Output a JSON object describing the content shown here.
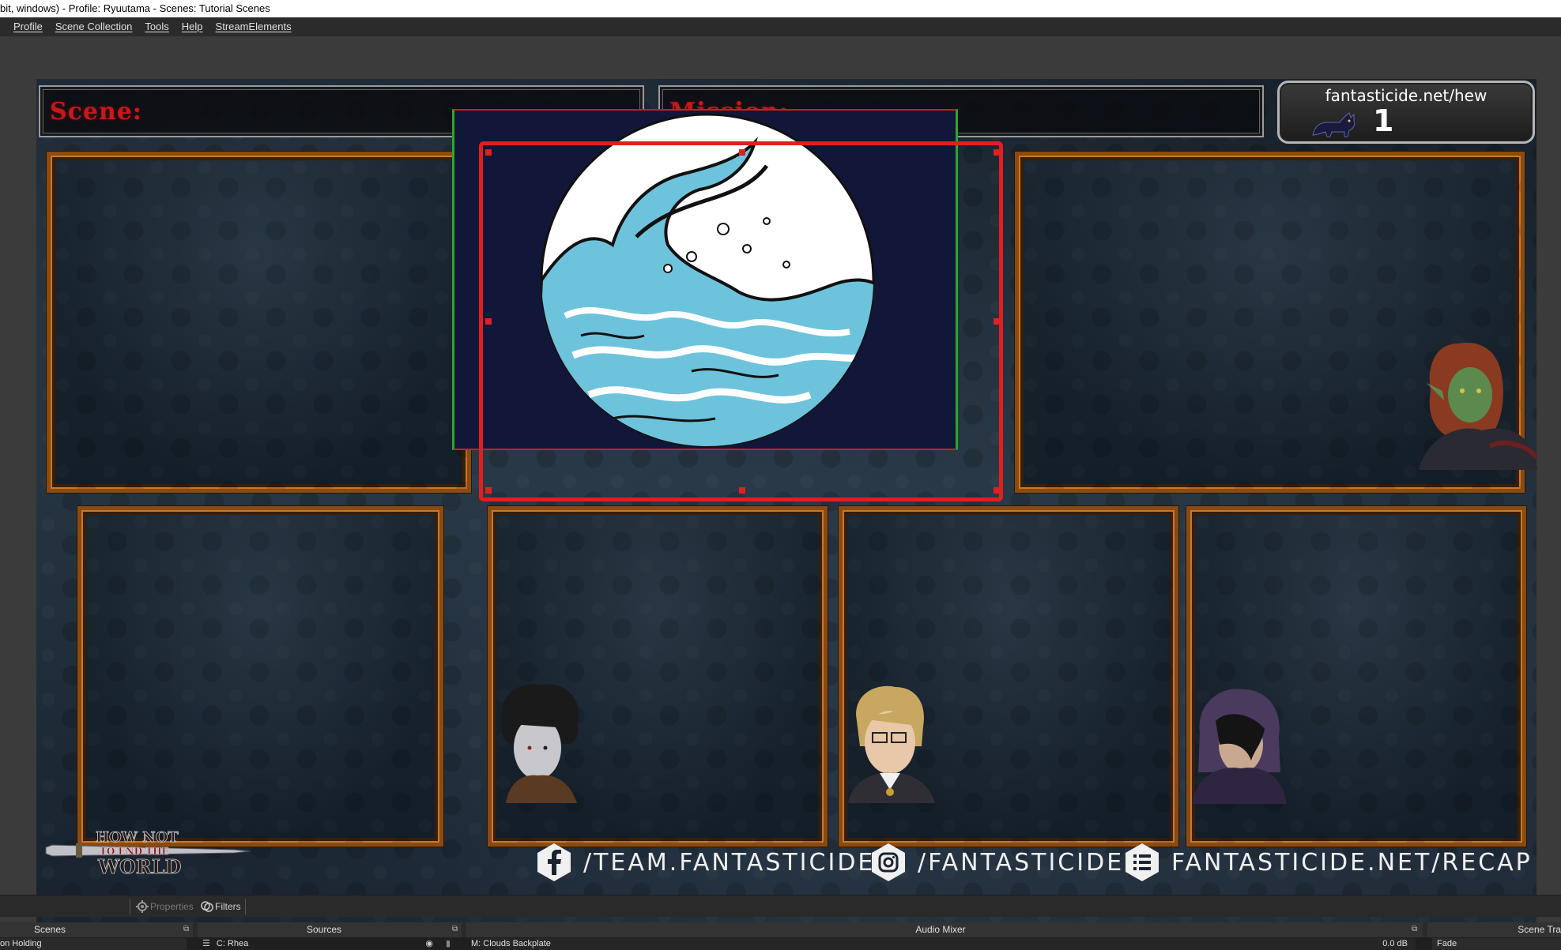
{
  "window": {
    "title": "bit, windows) - Profile: Ryuutama - Scenes: Tutorial Scenes"
  },
  "menu": [
    {
      "label": "Profile"
    },
    {
      "label": "Scene Collection"
    },
    {
      "label": "Tools"
    },
    {
      "label": "Help"
    },
    {
      "label": "StreamElements"
    }
  ],
  "overlay": {
    "scene_label": "Scene:",
    "mission_label": "Mission:",
    "url_text": "fantasticide.net/hew",
    "url_count": "1",
    "social": [
      {
        "icon": "facebook-icon",
        "text": "/TEAM.FANTASTICIDE"
      },
      {
        "icon": "instagram-icon",
        "text": "/FANTASTICIDE"
      },
      {
        "icon": "list-icon",
        "text": "FANTASTICIDE.NET/RECAP"
      }
    ],
    "logo_lines": [
      "HOW NOT",
      "TO END THE",
      "WORLD"
    ]
  },
  "toolbar": {
    "properties_label": "Properties",
    "filters_label": "Filters"
  },
  "docks": {
    "scenes": {
      "title": "Scenes",
      "row": "on Holding"
    },
    "sources": {
      "title": "Sources",
      "row": "C: Rhea"
    },
    "audio_mixer": {
      "title": "Audio Mixer",
      "row": "M: Clouds Backplate",
      "level": "0.0 dB"
    },
    "transitions": {
      "title": "Scene Tra",
      "row": "Fade"
    }
  },
  "colors": {
    "accent_red": "#e02020",
    "frame_orange": "#8a4a12",
    "label_red": "#c81818",
    "bounding_green": "#2aa82a"
  }
}
